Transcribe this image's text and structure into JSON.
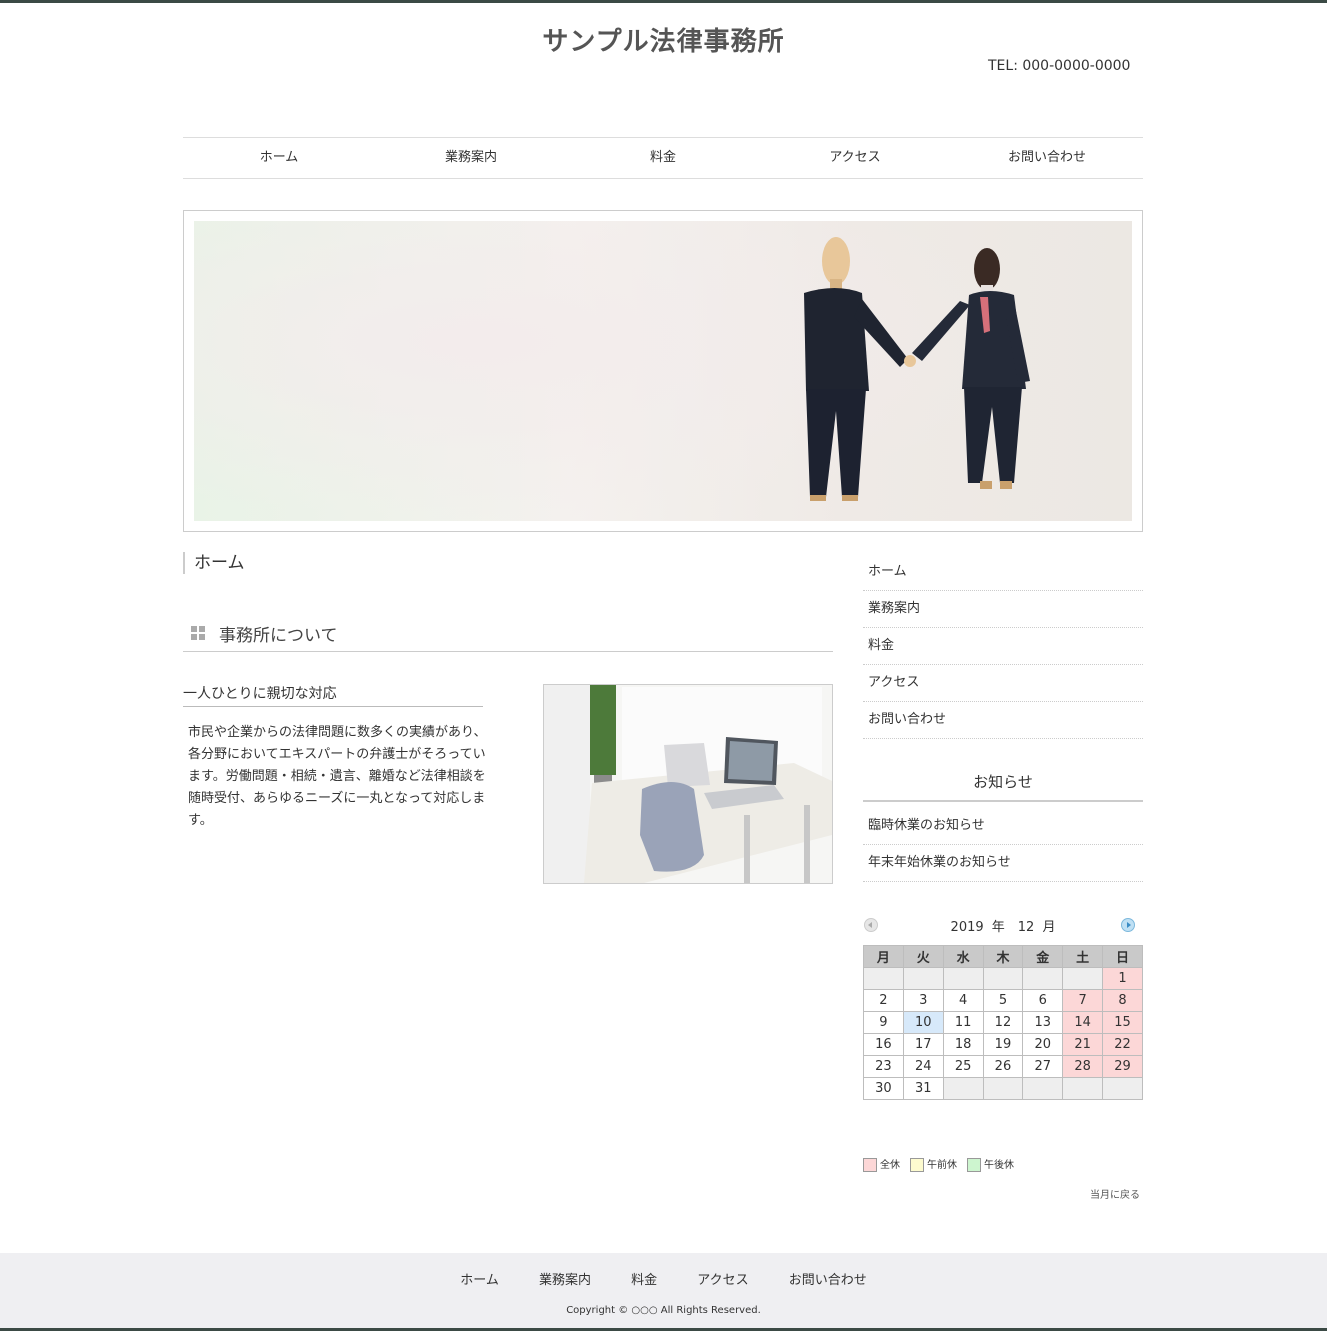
{
  "header": {
    "title": "サンプル法律事務所",
    "tel": "TEL: 000-0000-0000"
  },
  "global_nav": [
    {
      "label": "ホーム"
    },
    {
      "label": "業務案内"
    },
    {
      "label": "料金"
    },
    {
      "label": "アクセス"
    },
    {
      "label": "お問い合わせ"
    }
  ],
  "main": {
    "breadcrumb": "ホーム",
    "section_title": "事務所について",
    "subtitle": "一人ひとりに親切な対応",
    "body": "市民や企業からの法律問題に数多くの実績があり、各分野においてエキスパートの弁護士がそろっています。労働問題・相続・遺言、離婚など法律相談を随時受付、あらゆるニーズに一丸となって対応します。"
  },
  "sidebar": {
    "menu": [
      {
        "label": "ホーム"
      },
      {
        "label": "業務案内"
      },
      {
        "label": "料金"
      },
      {
        "label": "アクセス"
      },
      {
        "label": "お問い合わせ"
      }
    ],
    "news_title": "お知らせ",
    "news": [
      {
        "label": "臨時休業のお知らせ"
      },
      {
        "label": "年末年始休業のお知らせ"
      }
    ]
  },
  "calendar": {
    "title": "2019 年　12 月",
    "weekdays": [
      "月",
      "火",
      "水",
      "木",
      "金",
      "土",
      "日"
    ],
    "weeks": [
      [
        "",
        "",
        "",
        "",
        "",
        "",
        "1"
      ],
      [
        "2",
        "3",
        "4",
        "5",
        "6",
        "7",
        "8"
      ],
      [
        "9",
        "10",
        "11",
        "12",
        "13",
        "14",
        "15"
      ],
      [
        "16",
        "17",
        "18",
        "19",
        "20",
        "21",
        "22"
      ],
      [
        "23",
        "24",
        "25",
        "26",
        "27",
        "28",
        "29"
      ],
      [
        "30",
        "31",
        "",
        "",
        "",
        "",
        ""
      ]
    ],
    "holidays": [
      "1",
      "7",
      "8",
      "14",
      "15",
      "21",
      "22",
      "28",
      "29"
    ],
    "today": "10",
    "legend": [
      {
        "label": "全休",
        "color": "#fcd7d7"
      },
      {
        "label": "午前休",
        "color": "#fdfbcf"
      },
      {
        "label": "午後休",
        "color": "#cdf5cf"
      }
    ],
    "back_label": "当月に戻る"
  },
  "footer": {
    "nav": [
      {
        "label": "ホーム"
      },
      {
        "label": "業務案内"
      },
      {
        "label": "料金"
      },
      {
        "label": "アクセス"
      },
      {
        "label": "お問い合わせ"
      }
    ],
    "copyright": "Copyright © ○○○ All Rights Reserved."
  },
  "icons": {
    "section": "grid-icon",
    "cal_prev": "prev-month-icon",
    "cal_next": "next-month-icon"
  },
  "colors": {
    "accent_border": "#3b4a45",
    "holiday": "#fcd7d7",
    "today": "#d7e9fa",
    "footer_bg": "#efeff2"
  }
}
